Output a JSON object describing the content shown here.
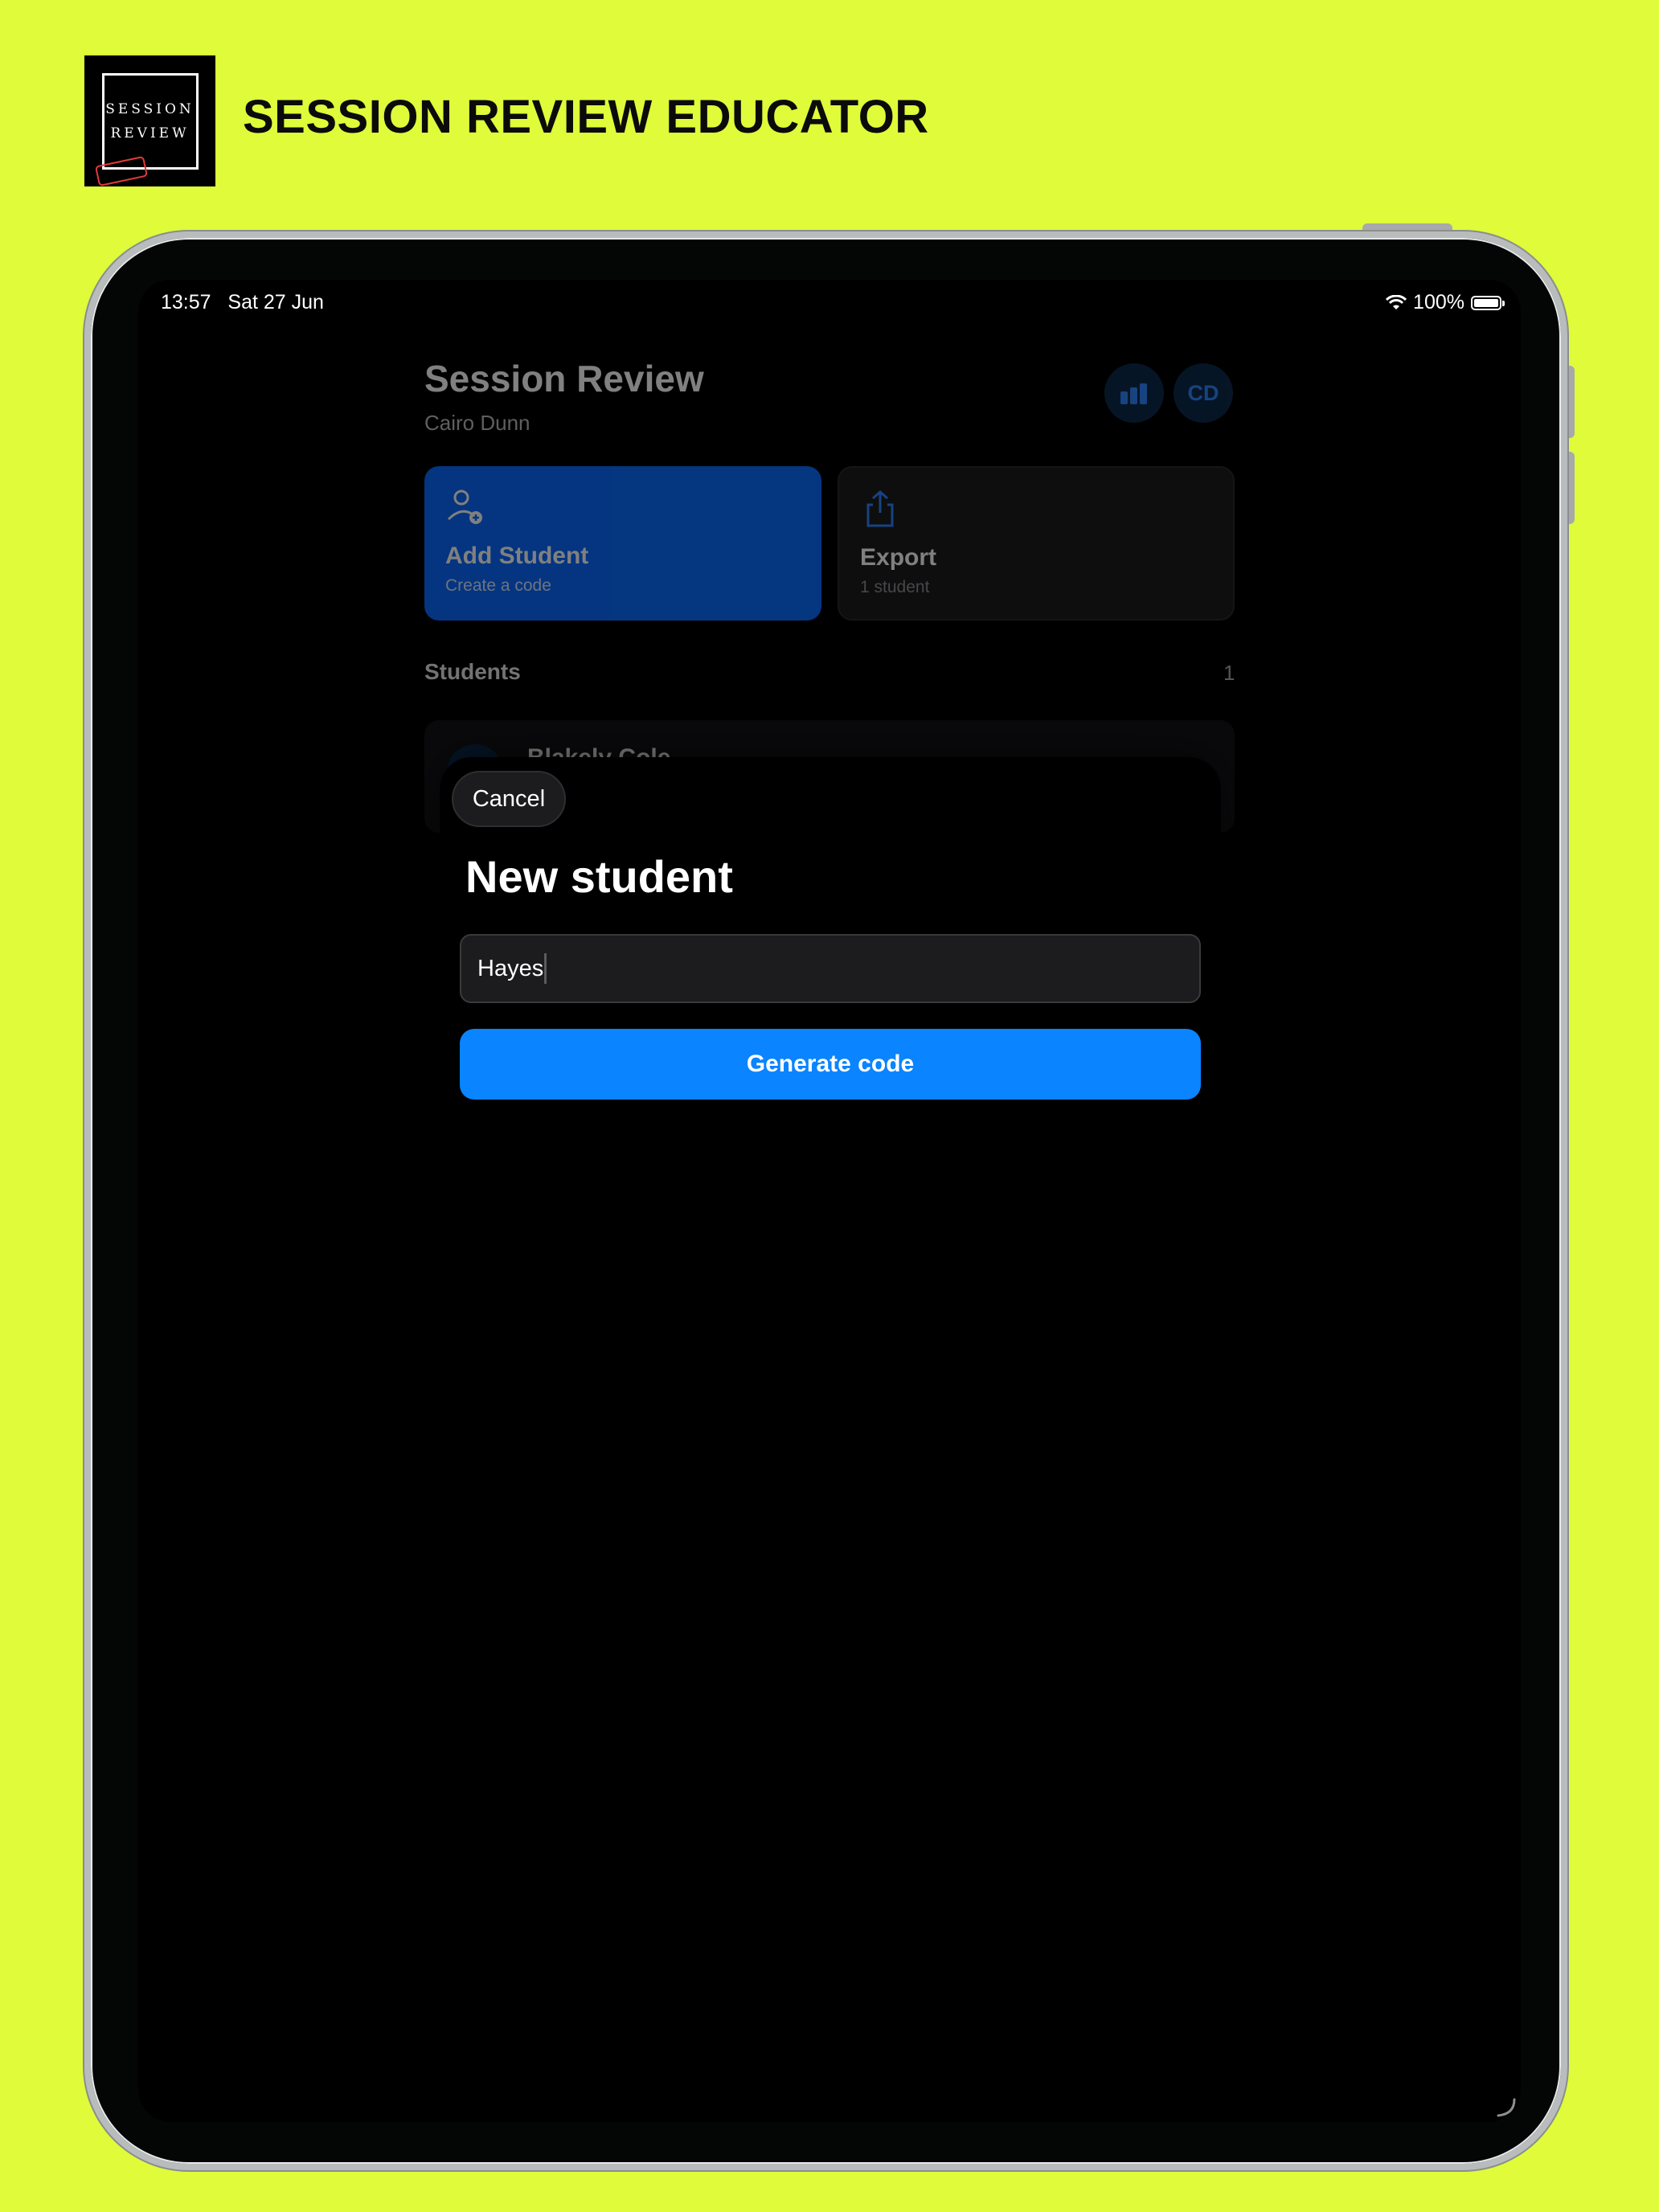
{
  "banner": {
    "logo_line1": "SESSION",
    "logo_line2": "REVIEW",
    "title": "SESSION REVIEW EDUCATOR"
  },
  "status_bar": {
    "time": "13:57",
    "date": "Sat 27 Jun",
    "battery": "100%",
    "icons": [
      "wifi-icon",
      "battery-icon"
    ]
  },
  "app": {
    "title": "Session Review",
    "subtitle": "Cairo Dunn",
    "avatar_initials": "CD",
    "actions": [
      {
        "title": "Add Student",
        "subtitle": "Create a code",
        "icon": "add-person-icon"
      },
      {
        "title": "Export",
        "subtitle": "1 student",
        "icon": "share-icon"
      }
    ],
    "students_label": "Students",
    "students_count": "1",
    "students": [
      {
        "name": "Blakely Cole"
      }
    ]
  },
  "modal": {
    "cancel_label": "Cancel",
    "title": "New student",
    "input_value": "Hayes",
    "generate_label": "Generate code"
  },
  "colors": {
    "background": "#dffb3a",
    "accent": "#0a84ff",
    "card_add": "#0a6bff"
  }
}
